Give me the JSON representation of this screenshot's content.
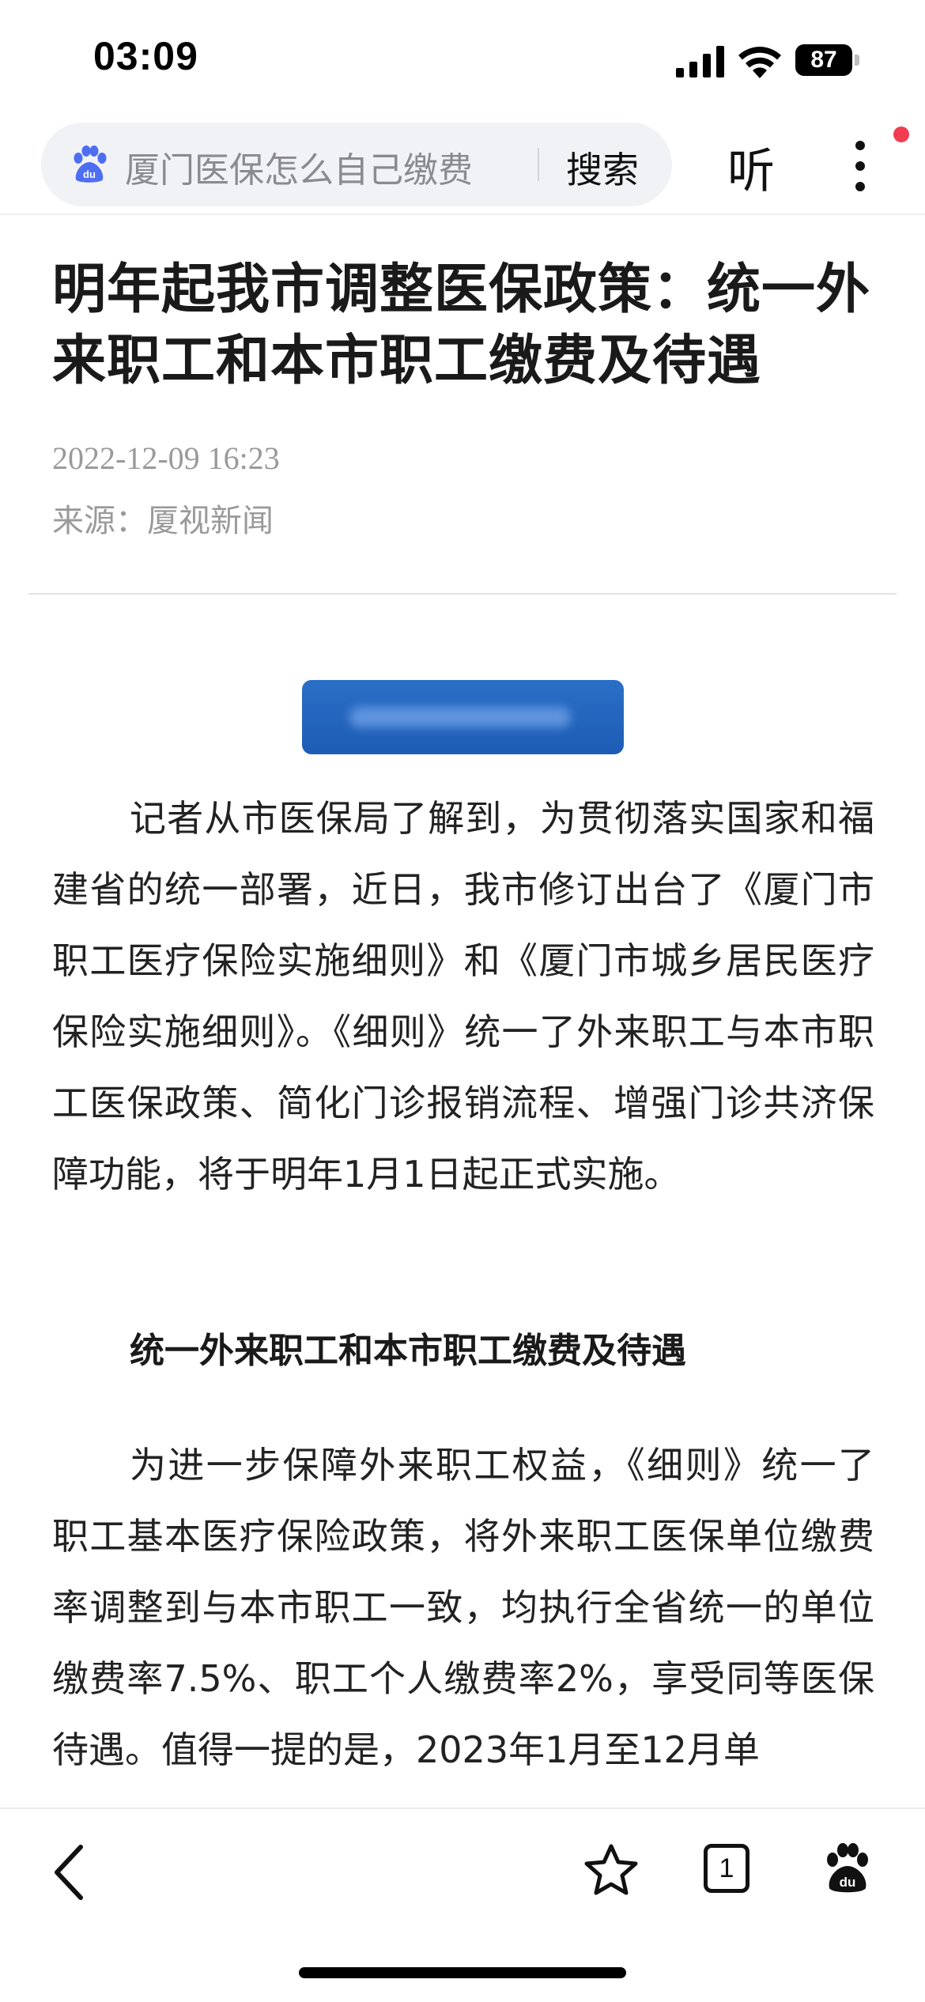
{
  "status_bar": {
    "time": "03:09",
    "battery": "87"
  },
  "browser": {
    "search_query": "厦门医保怎么自己缴费",
    "search_label": "搜索",
    "listen_label": "听"
  },
  "article": {
    "title": "明年起我市调整医保政策：统一外来职工和本市职工缴费及待遇",
    "date": "2022-12-09 16:23",
    "source": "来源：厦视新闻",
    "paragraphs": [
      "记者从市医保局了解到，为贯彻落实国家和福建省的统一部署，近日，我市修订出台了《厦门市职工医疗保险实施细则》和《厦门市城乡居民医疗保险实施细则》。《细则》统一了外来职工与本市职工医保政策、简化门诊报销流程、增强门诊共济保障功能，将于明年1月1日起正式实施。",
      "为进一步保障外来职工权益，《细则》统一了职工基本医疗保险政策，将外来职工医保单位缴费率调整到与本市职工一致，均执行全省统一的单位缴费率7.5%、职工个人缴费率2%，享受同等医保待遇。值得一提的是，2023年1月至12月单"
    ],
    "section_heading": "统一外来职工和本市职工缴费及待遇"
  },
  "toolbar": {
    "tab_count": "1"
  },
  "colors": {
    "banner_blue": "#1e5cb5",
    "notify_red": "#f23c4f",
    "baidu_blue": "#4e6ef2"
  }
}
